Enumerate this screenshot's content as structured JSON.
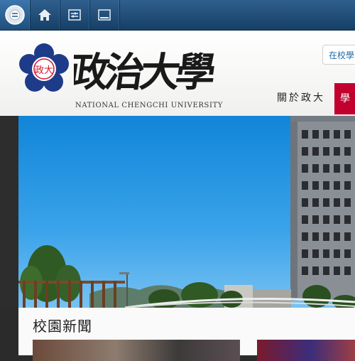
{
  "toolbar": {
    "buttons": [
      {
        "icon": "ncu-logo-icon",
        "active": true
      },
      {
        "icon": "home-icon"
      },
      {
        "icon": "settings-sliders-icon"
      },
      {
        "icon": "window-icon"
      }
    ]
  },
  "header": {
    "university_name_en": "NATIONAL CHENGCHI UNIVERSITY",
    "logo_text": "政治大學",
    "emblem_text": "政大",
    "search_placeholder": "在校學",
    "nav_about": "關於政大",
    "nav_highlight": "學"
  },
  "news": {
    "section_title": "校園新聞"
  },
  "colors": {
    "toolbar": "#1d4b76",
    "brand_blue": "#1e3b8a",
    "nav_red": "#c2002d",
    "link_blue": "#1d6aa8"
  }
}
